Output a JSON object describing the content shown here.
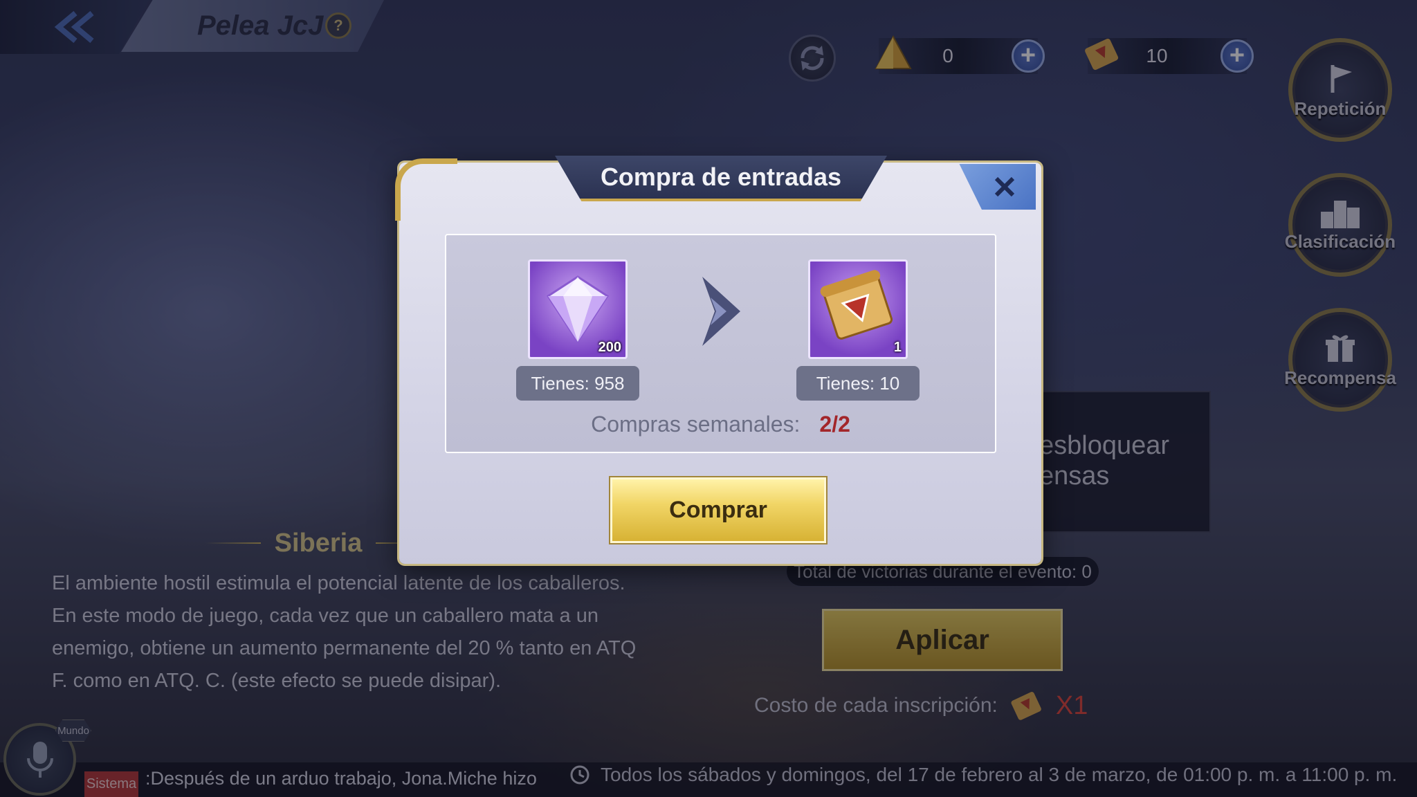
{
  "header": {
    "title": "Pelea JcJ",
    "help": "?"
  },
  "currencies": [
    {
      "icon": "tetrahedron-icon",
      "value": "0"
    },
    {
      "icon": "scroll-ticket-icon",
      "value": "10"
    }
  ],
  "side_menu": [
    {
      "label": "Repetición",
      "icon": "flag-icon"
    },
    {
      "label": "Clasificación",
      "icon": "podium-icon"
    },
    {
      "label": "Recompensa",
      "icon": "gift-icon"
    }
  ],
  "background": {
    "stage_name": "Siberia",
    "stage_description": "El ambiente hostil estimula el potencial latente de los caballeros. En este modo de juego, cada vez que un caballero mata a un enemigo, obtiene un aumento permanente del 20 % tanto en ATQ F. como en ATQ. C. (este efecto se puede disipar).",
    "unlock_text_line1": "esbloquear",
    "unlock_text_line2": "ensas",
    "victories": "Total de victorias durante el evento: 0",
    "apply_label": "Aplicar",
    "cost_label": "Costo de cada inscripción:",
    "cost_multiplier": "X1",
    "schedule": "Todos los sábados y domingos, del 17 de febrero al 3 de marzo, de 01:00 p. m. a 11:00 p. m."
  },
  "chat": {
    "channel": "Mundo",
    "tag": "Sistema",
    "message": ":Después de un arduo trabajo, Jona.Miche hizo"
  },
  "modal": {
    "title": "Compra de entradas",
    "cost_item": {
      "icon": "diamond-icon",
      "quantity": "200",
      "have": "Tienes: 958"
    },
    "reward_item": {
      "icon": "scroll-ticket-icon",
      "quantity": "1",
      "have": "Tienes: 10"
    },
    "weekly_label": "Compras semanales:",
    "weekly_count": "2/2",
    "buy_label": "Comprar"
  },
  "colors": {
    "accent_gold": "#c9a74d",
    "close_blue": "#4a73c4",
    "weekly_count_red": "#a3262a",
    "buy_button": "#f1d566"
  }
}
